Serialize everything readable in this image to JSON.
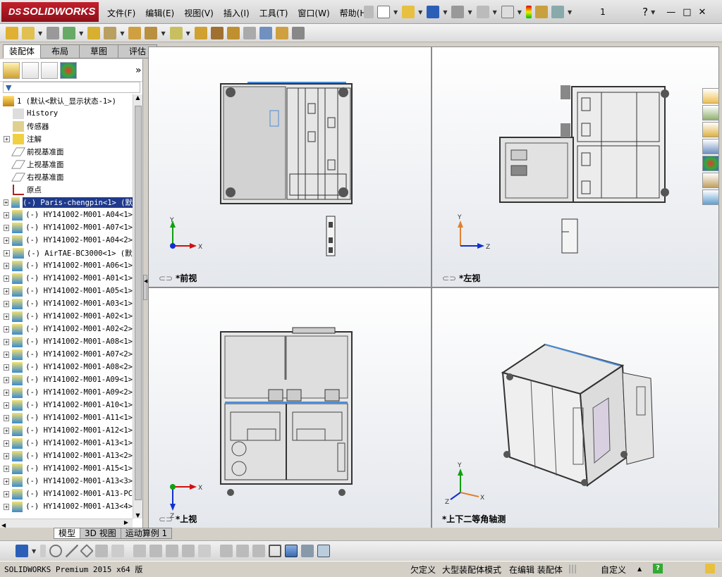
{
  "app": {
    "brand": "SOLIDWORKS",
    "brand_prefix": "DS"
  },
  "menu": [
    "文件(F)",
    "编辑(E)",
    "视图(V)",
    "插入(I)",
    "工具(T)",
    "窗口(W)",
    "帮助(H)"
  ],
  "toolbar": {
    "config_number": "1",
    "help_glyph": "?"
  },
  "tabs": [
    "装配体",
    "布局",
    "草图",
    "评估"
  ],
  "tree": {
    "root": "1  (默认<默认_显示状态-1>)",
    "items": [
      {
        "label": "History",
        "icon": "history-icon"
      },
      {
        "label": "传感器",
        "icon": "sensor-icon"
      },
      {
        "label": "注解",
        "icon": "annotation-icon",
        "expand": true
      },
      {
        "label": "前视基准面",
        "icon": "plane-icon"
      },
      {
        "label": "上视基准面",
        "icon": "plane-icon"
      },
      {
        "label": "右视基准面",
        "icon": "plane-icon"
      },
      {
        "label": "原点",
        "icon": "origin-icon"
      },
      {
        "label": "(-) Paris-chengpin<1> (默",
        "icon": "part-icon",
        "selected": true,
        "expand": true
      },
      {
        "label": "(-) HY141002-M001-A04<1>",
        "icon": "part-icon",
        "expand": true
      },
      {
        "label": "(-) HY141002-M001-A07<1>",
        "icon": "part-icon",
        "expand": true
      },
      {
        "label": "(-) HY141002-M001-A04<2>",
        "icon": "part-icon",
        "expand": true
      },
      {
        "label": "(-) AirTAE-BC3000<1> (默",
        "icon": "part-icon",
        "expand": true
      },
      {
        "label": "(-) HY141002-M001-A06<1>",
        "icon": "part-icon",
        "expand": true
      },
      {
        "label": "(-) HY141002-M001-A01<1>",
        "icon": "part-icon",
        "expand": true
      },
      {
        "label": "(-) HY141002-M001-A05<1>",
        "icon": "part-icon",
        "expand": true
      },
      {
        "label": "(-) HY141002-M001-A03<1>",
        "icon": "part-icon",
        "expand": true
      },
      {
        "label": "(-) HY141002-M001-A02<1>",
        "icon": "part-icon",
        "expand": true
      },
      {
        "label": "(-) HY141002-M001-A02<2>",
        "icon": "part-icon",
        "expand": true
      },
      {
        "label": "(-) HY141002-M001-A08<1>",
        "icon": "part-icon",
        "expand": true
      },
      {
        "label": "(-) HY141002-M001-A07<2>",
        "icon": "part-icon",
        "expand": true
      },
      {
        "label": "(-) HY141002-M001-A08<2>",
        "icon": "part-icon",
        "expand": true
      },
      {
        "label": "(-) HY141002-M001-A09<1>",
        "icon": "part-icon",
        "expand": true
      },
      {
        "label": "(-) HY141002-M001-A09<2>",
        "icon": "part-icon",
        "expand": true
      },
      {
        "label": "(-) HY141002-M001-A10<1>",
        "icon": "part-icon",
        "expand": true
      },
      {
        "label": "(-) HY141002-M001-A11<1>",
        "icon": "part-icon",
        "expand": true
      },
      {
        "label": "(-) HY141002-M001-A12<1>",
        "icon": "part-icon",
        "expand": true
      },
      {
        "label": "(-) HY141002-M001-A13<1>",
        "icon": "part-icon",
        "expand": true
      },
      {
        "label": "(-) HY141002-M001-A13<2>",
        "icon": "part-icon",
        "expand": true
      },
      {
        "label": "(-) HY141002-M001-A15<1>",
        "icon": "part-icon",
        "expand": true
      },
      {
        "label": "(-) HY141002-M001-A13<3>",
        "icon": "part-icon",
        "expand": true
      },
      {
        "label": "(-) HY141002-M001-A13-PC",
        "icon": "part-icon",
        "expand": true
      },
      {
        "label": "(-) HY141002-M001-A13<4>",
        "icon": "part-icon",
        "expand": true
      }
    ]
  },
  "viewports": [
    {
      "label": "*前视",
      "axes": [
        "Y",
        "X"
      ]
    },
    {
      "label": "*左视",
      "axes": [
        "Y",
        "Z"
      ]
    },
    {
      "label": "*上视",
      "axes": [
        "X",
        "Z"
      ]
    },
    {
      "label": "*上下二等角轴测",
      "axes": [
        "Y",
        "X",
        "Z"
      ]
    }
  ],
  "bottom_tabs": [
    "模型",
    "3D 视图",
    "运动算例 1"
  ],
  "status": {
    "version": "SOLIDWORKS Premium 2015 x64 版",
    "constraint": "欠定义",
    "mode": "大型装配体模式",
    "editing": "在编辑 装配体",
    "units": "自定义"
  },
  "colors": {
    "accent": "#1f3a8c",
    "brand_red": "#c3202c",
    "axis_red": "#d01010",
    "axis_green": "#10a010",
    "axis_blue": "#1030d0"
  }
}
